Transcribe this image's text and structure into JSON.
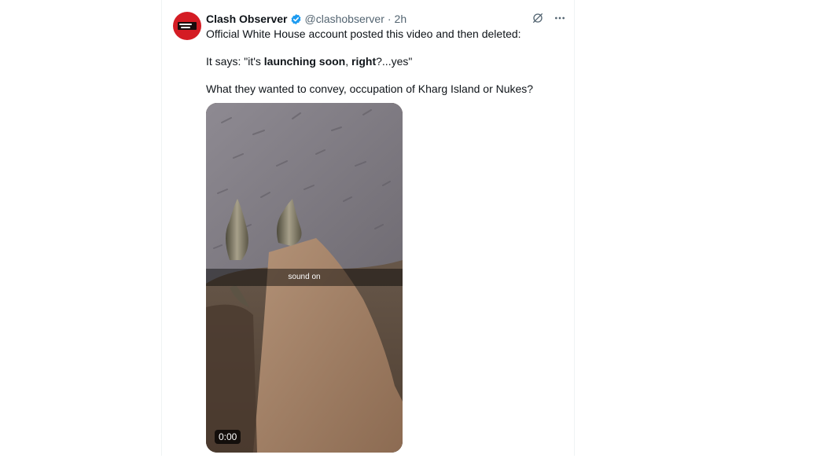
{
  "tweet": {
    "display_name": "Clash Observer",
    "handle": "@clashobserver",
    "separator": "·",
    "time": "2h",
    "verified": true,
    "avatar_icon": "clash-observer-logo",
    "line1": "Official White House account posted this video and then deleted:",
    "line2": {
      "prefix": "It says: \"it's ",
      "bold1": "launching soon",
      "comma": ", ",
      "bold2": "right",
      "suffix": "?...yes\""
    },
    "line3": "What they wanted to convey, occupation of Kharg Island or Nukes?"
  },
  "actions": {
    "grok_icon": "grok-icon",
    "more_icon": "more-icon"
  },
  "video": {
    "sound_label": "sound on",
    "time": "0:00"
  },
  "colors": {
    "verified": "#1d9bf0",
    "avatar_bg": "#d41c24",
    "secondary_text": "#536471"
  }
}
